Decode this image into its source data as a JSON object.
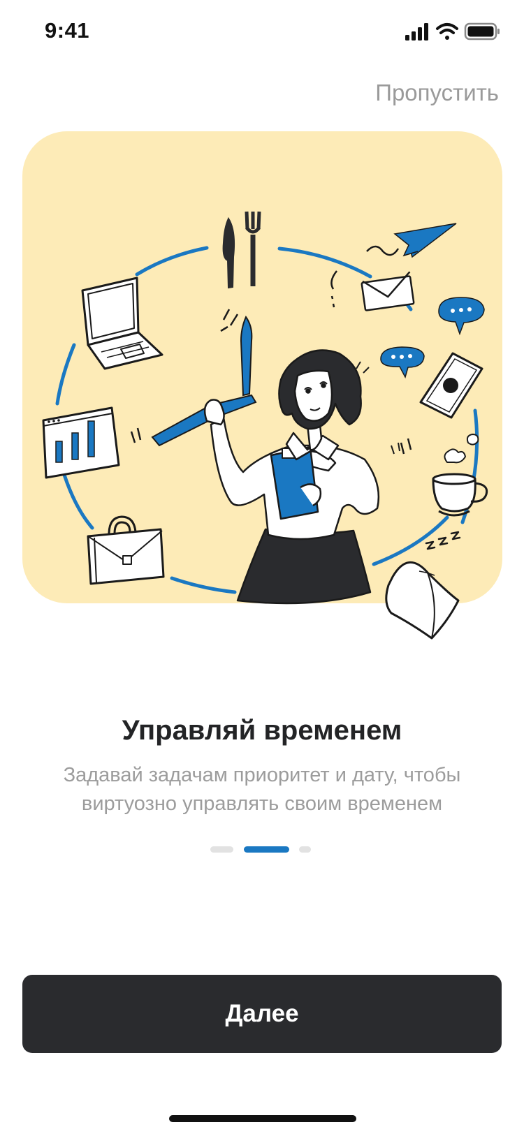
{
  "status_bar": {
    "time": "9:41",
    "icons": [
      "cellular-signal-icon",
      "wifi-icon",
      "battery-icon"
    ]
  },
  "header": {
    "skip_label": "Пропустить"
  },
  "illustration": {
    "subject": "woman-juggling-daily-tasks-illustration",
    "icons": [
      "cutlery-icon",
      "paper-plane-icon",
      "envelope-icon",
      "chat-bubble-icon",
      "laptop-icon",
      "clock-hands-icon",
      "smartphone-icon",
      "bar-chart-icon",
      "teacup-icon",
      "briefcase-icon",
      "pillow-icon"
    ]
  },
  "content": {
    "title": "Управляй временем",
    "description": "Задавай задачам приоритет и дату, чтобы виртуозно управлять своим временем"
  },
  "pagination": {
    "total": 3,
    "active_index": 1
  },
  "footer": {
    "next_label": "Далее"
  },
  "colors": {
    "accent": "#1a78c2",
    "card_background": "#fdebb7",
    "button_background": "#2a2b2e",
    "muted_text": "#9c9c9c"
  }
}
